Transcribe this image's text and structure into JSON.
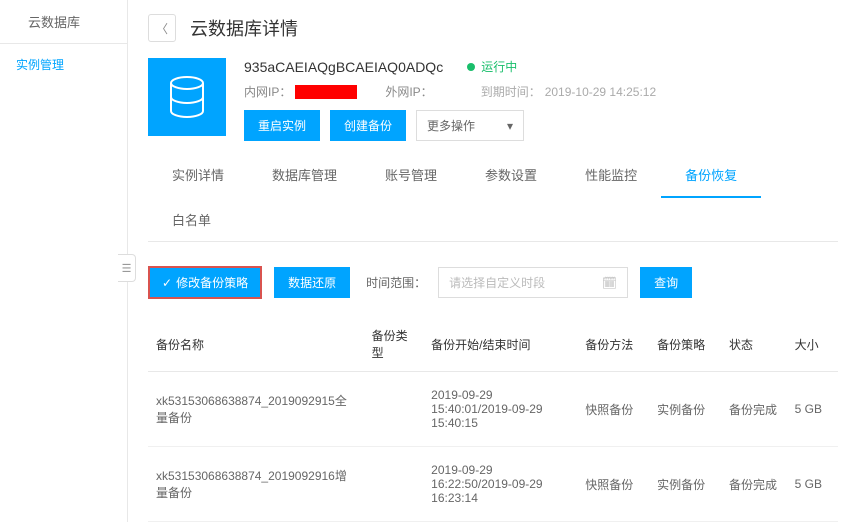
{
  "sidebar": {
    "title": "云数据库",
    "items": [
      {
        "label": "实例管理"
      }
    ]
  },
  "header": {
    "title": "云数据库详情"
  },
  "instance": {
    "id": "935aCAEIAQgBCAEIAQ0ADQc",
    "status_text": "运行中",
    "inner_ip_label": "内网IP：",
    "outer_ip_label": "外网IP：",
    "expire_label": "到期时间：",
    "expire_value": "2019-10-29 14:25:12",
    "restart_btn": "重启实例",
    "create_backup_btn": "创建备份",
    "more_ops": "更多操作"
  },
  "tabs": [
    {
      "label": "实例详情"
    },
    {
      "label": "数据库管理"
    },
    {
      "label": "账号管理"
    },
    {
      "label": "参数设置"
    },
    {
      "label": "性能监控"
    },
    {
      "label": "备份恢复",
      "active": true
    },
    {
      "label": "白名单"
    }
  ],
  "toolbar": {
    "modify_strategy": "修改备份策略",
    "restore_data": "数据还原",
    "time_range_label": "时间范围：",
    "time_placeholder": "请选择自定义时段",
    "query_btn": "查询"
  },
  "table": {
    "headers": {
      "name": "备份名称",
      "type": "备份类型",
      "time": "备份开始/结束时间",
      "method": "备份方法",
      "strategy": "备份策略",
      "status": "状态",
      "size": "大小"
    },
    "rows": [
      {
        "name": "xk53153068638874_2019092915全量备份",
        "type": "",
        "time": "2019-09-29 15:40:01/2019-09-29 15:40:15",
        "method": "快照备份",
        "strategy": "实例备份",
        "status": "备份完成",
        "size": "5 GB"
      },
      {
        "name": "xk53153068638874_2019092916增量备份",
        "type": "",
        "time": "2019-09-29 16:22:50/2019-09-29 16:23:14",
        "method": "快照备份",
        "strategy": "实例备份",
        "status": "备份完成",
        "size": "5 GB"
      }
    ]
  }
}
